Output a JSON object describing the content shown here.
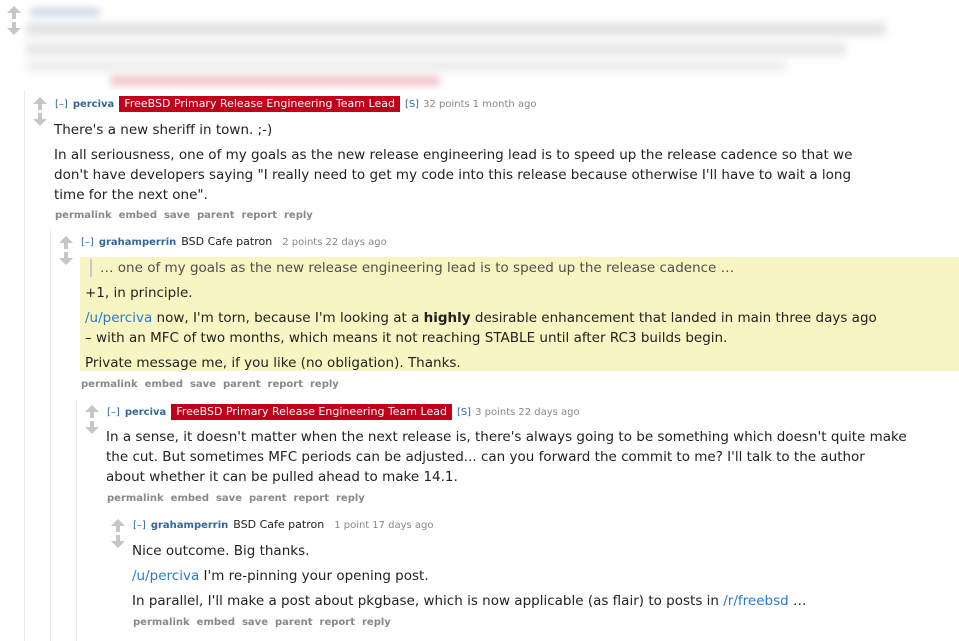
{
  "comments": [
    {
      "author": "perciva",
      "flair": "FreeBSD Primary Release Engineering Team Lead",
      "submitter_tag": "[S]",
      "score": "32 points",
      "time": "1 month ago",
      "body": [
        "There's a new sheriff in town. ;-)",
        "In all seriousness, one of my goals as the new release engineering lead is to speed up the release cadence so that we",
        "don't have developers saying \"I really need to get my code into this release because otherwise I'll have to wait a long",
        "time for the next one\"."
      ]
    },
    {
      "author": "grahamperrin",
      "flair": "BSD Cafe patron",
      "score": "2 points",
      "time": "22 days ago",
      "quote": "… one of my goals as the new release engineering lead is to speed up the release cadence …",
      "line1": "+1, in principle.",
      "mention": "/u/perciva",
      "line2a": " now, I'm torn, because I'm looking at a ",
      "line2b": "highly",
      "line2c": " desirable enhancement that landed in main three days ago",
      "line3": "– with an MFC of two months, which means it not reaching STABLE until after RC3 builds begin.",
      "line4": "Private message me, if you like (no obligation). Thanks."
    },
    {
      "author": "perciva",
      "flair": "FreeBSD Primary Release Engineering Team Lead",
      "submitter_tag": "[S]",
      "score": "3 points",
      "time": "22 days ago",
      "body": [
        "In a sense, it doesn't matter when the next release is, there's always going to be something which doesn't quite make",
        "the cut. But sometimes MFC periods can be adjusted... can you forward the commit to me? I'll talk to the author",
        "about whether it can be pulled ahead to make 14.1."
      ]
    },
    {
      "author": "grahamperrin",
      "flair": "BSD Cafe patron",
      "score": "1 point",
      "time": "17 days ago",
      "line1": "Nice outcome. Big thanks.",
      "mention": "/u/perciva",
      "line2": " I'm re-pinning your opening post.",
      "line3a": "In parallel, I'll make a post about pkgbase, which is now applicable (as flair) to posts in ",
      "line3_link": "/r/freebsd",
      "line3b": " …"
    }
  ],
  "ui": {
    "expand": "[–]",
    "buttons": {
      "permalink": "permalink",
      "embed": "embed",
      "save": "save",
      "parent": "parent",
      "report": "report",
      "reply": "reply"
    }
  },
  "colors": {
    "flair_bg": "#c0001a",
    "author": "#336699",
    "link": "#2a7acc",
    "highlight_bg": "#f7f6c2"
  }
}
